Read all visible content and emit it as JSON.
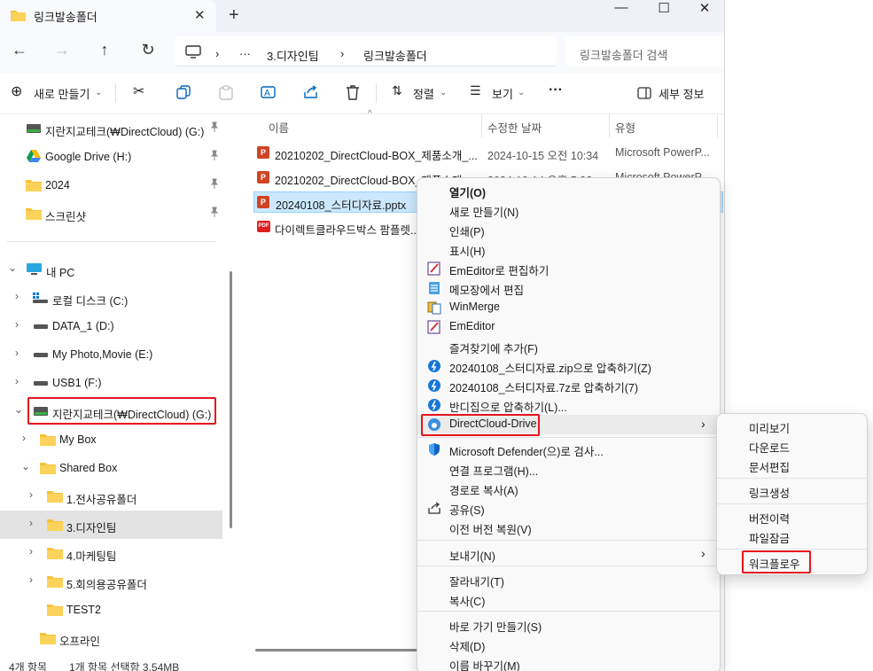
{
  "tab": {
    "title": "링크발송폴더",
    "close": "✕",
    "new": "+"
  },
  "window_controls": {
    "minimize": "—",
    "maximize": "☐",
    "close": "✕"
  },
  "address": {
    "sep": "›",
    "more": "···",
    "crumbs": [
      "3.디자인팀",
      "링크발송폴더"
    ]
  },
  "search": {
    "placeholder": "링크발송폴더 검색"
  },
  "toolbar": {
    "new_label": "새로 만들기",
    "sort_label": "정렬",
    "view_label": "보기",
    "more": "···",
    "details_label": "세부 정보"
  },
  "sidebar": {
    "pinned": [
      {
        "label": "지란지교테크(₩DirectCloud) (G:)"
      },
      {
        "label": "Google Drive (H:)"
      },
      {
        "label": "2024"
      },
      {
        "label": "스크린샷"
      }
    ],
    "tree": [
      {
        "label": "내 PC"
      },
      {
        "label": "로컬 디스크 (C:)"
      },
      {
        "label": "DATA_1 (D:)"
      },
      {
        "label": "My Photo,Movie (E:)"
      },
      {
        "label": "USB1 (F:)"
      },
      {
        "label": "지란지교테크(₩DirectCloud) (G:)"
      },
      {
        "label": "My Box"
      },
      {
        "label": "Shared Box"
      },
      {
        "label": "1.전사공유폴더"
      },
      {
        "label": "3.디자인팀"
      },
      {
        "label": "4.마케팅팀"
      },
      {
        "label": "5.회의용공유폴더"
      },
      {
        "label": "TEST2"
      },
      {
        "label": "오프라인"
      }
    ]
  },
  "columns": {
    "name": "이름",
    "modified": "수정한 날짜",
    "type": "유형"
  },
  "files": [
    {
      "name": "20210202_DirectCloud-BOX_제품소개_...",
      "date": "2024-10-15 오전 10:34",
      "type": "Microsoft PowerP..."
    },
    {
      "name": "20210202_DirectCloud-BOX_제품소개...",
      "date": "2024-10-14 오후 5:32",
      "type": "Microsoft PowerP..."
    },
    {
      "name": "20240108_스터디자료.pptx",
      "date": "",
      "type": ""
    },
    {
      "name": "다이렉트클라우드박스 팜플렛...",
      "date": "",
      "type": ""
    }
  ],
  "status": {
    "count": "4개 항목",
    "selection": "1개 항목 선택함 3.54MB"
  },
  "context_menu": {
    "items": [
      {
        "label": "열기(O)",
        "bold": true
      },
      {
        "label": "새로 만들기(N)"
      },
      {
        "label": "인쇄(P)"
      },
      {
        "label": "표시(H)"
      },
      {
        "label": "EmEditor로 편집하기",
        "icon": "emeditor-icon"
      },
      {
        "label": "메모장에서 편집",
        "icon": "notepad-icon"
      },
      {
        "label": "WinMerge",
        "icon": "winmerge-icon"
      },
      {
        "label": "EmEditor",
        "icon": "emeditor-icon"
      },
      {
        "label": "즐겨찾기에 추가(F)"
      },
      {
        "label": "20240108_스터디자료.zip으로 압축하기(Z)",
        "icon": "bandizip-icon"
      },
      {
        "label": "20240108_스터디자료.7z로 압축하기(7)",
        "icon": "bandizip-icon"
      },
      {
        "label": "반디집으로 압축하기(L)...",
        "icon": "bandizip-icon"
      },
      {
        "label": "DirectCloud-Drive",
        "icon": "directcloud-icon",
        "submenu": true
      },
      {
        "label": "Microsoft Defender(으)로 검사...",
        "icon": "defender-icon"
      },
      {
        "label": "연결 프로그램(H)..."
      },
      {
        "label": "경로로 복사(A)"
      },
      {
        "label": "공유(S)",
        "icon": "share-icon"
      },
      {
        "label": "이전 버전 복원(V)"
      },
      {
        "label": "보내기(N)",
        "submenu": true
      },
      {
        "label": "잘라내기(T)"
      },
      {
        "label": "복사(C)"
      },
      {
        "label": "바로 가기 만들기(S)"
      },
      {
        "label": "삭제(D)"
      },
      {
        "label": "이름 바꾸기(M)"
      }
    ],
    "arrow": "›"
  },
  "submenu": {
    "items": [
      {
        "label": "미리보기"
      },
      {
        "label": "다운로드"
      },
      {
        "label": "문서편집"
      },
      {
        "label": "링크생성"
      },
      {
        "label": "버전이력"
      },
      {
        "label": "파일잠금"
      },
      {
        "label": "워크플로우"
      }
    ]
  },
  "colors": {
    "accent": "#0067c0",
    "highlight": "#e5141e",
    "selection": "#cce8ff",
    "folder": "#f7c23c"
  }
}
